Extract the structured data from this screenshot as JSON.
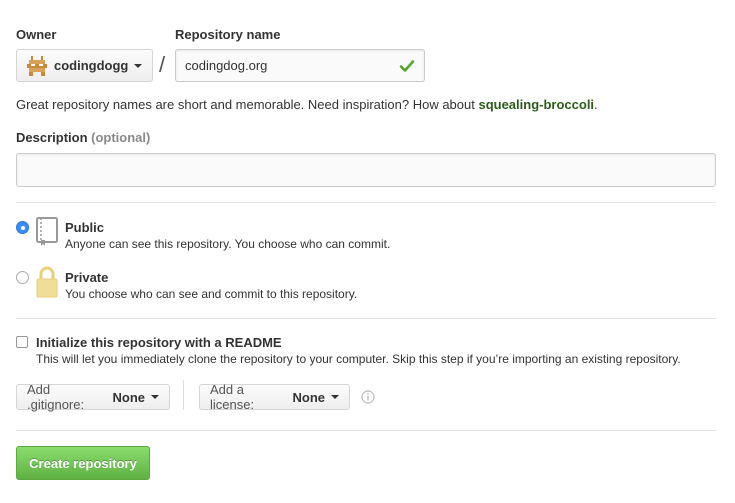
{
  "owner": {
    "label": "Owner",
    "value": "codingdogg"
  },
  "repository": {
    "label": "Repository name",
    "value": "codingdog.org",
    "separator": "/"
  },
  "hint": {
    "text": "Great repository names are short and memorable. Need inspiration? How about ",
    "suggestion": "squealing-broccoli",
    "end": "."
  },
  "description": {
    "label": "Description",
    "optional": "(optional)",
    "value": ""
  },
  "visibility": {
    "public": {
      "title": "Public",
      "desc": "Anyone can see this repository. You choose who can commit.",
      "selected": true
    },
    "private": {
      "title": "Private",
      "desc": "You choose who can see and commit to this repository.",
      "selected": false
    }
  },
  "readme": {
    "title": "Initialize this repository with a README",
    "desc": "This will let you immediately clone the repository to your computer. Skip this step if you’re importing an existing repository.",
    "checked": false
  },
  "gitignore": {
    "label": "Add .gitignore:",
    "value": "None"
  },
  "license": {
    "label": "Add a license:",
    "value": "None"
  },
  "actions": {
    "create": "Create repository"
  },
  "colors": {
    "accent_green": "#60b044",
    "suggestion_green": "#2c5c1a",
    "radio_blue": "#3b8ef5",
    "lock_gold": "#e8cf7c"
  }
}
